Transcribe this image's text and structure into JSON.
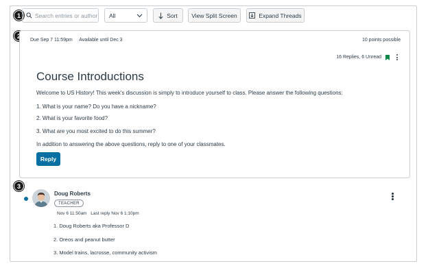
{
  "steps": [
    "1",
    "2",
    "3"
  ],
  "toolbar": {
    "search_placeholder": "Search entries or author",
    "filter_value": "All",
    "sort_label": "Sort",
    "split_label": "View Split Screen",
    "expand_label": "Expand Threads"
  },
  "topic": {
    "due": "Due Sep 7 11:59pm",
    "available": "Available until Dec 3",
    "points": "10 points possible",
    "replies": "16 Replies, 6 Unread",
    "title": "Course Introductions",
    "lines": [
      "Welcome to US History! This week's discussion is simply to introduce yourself to class. Please answer the following questions:",
      "1. What is your name? Do you have a nickname?",
      "2. What is your favorite food?",
      "3. What are you most excited to do this summer?",
      "In addition to answering the above questions, reply to one of your classmates."
    ],
    "reply_label": "Reply"
  },
  "entry": {
    "author": "Doug Roberts",
    "role": "TEACHER",
    "posted": "Nov 6 11:50am",
    "last_reply": "Last reply Nov 6 1:10pm",
    "lines": [
      "1. Doug Roberts aka Professor D",
      "2. Oreos and peanut butter",
      "3. Model trains, lacrosse, community activism"
    ]
  },
  "colors": {
    "accent": "#0770a3",
    "bookmark": "#0b874b",
    "text": "#2d3b45"
  }
}
